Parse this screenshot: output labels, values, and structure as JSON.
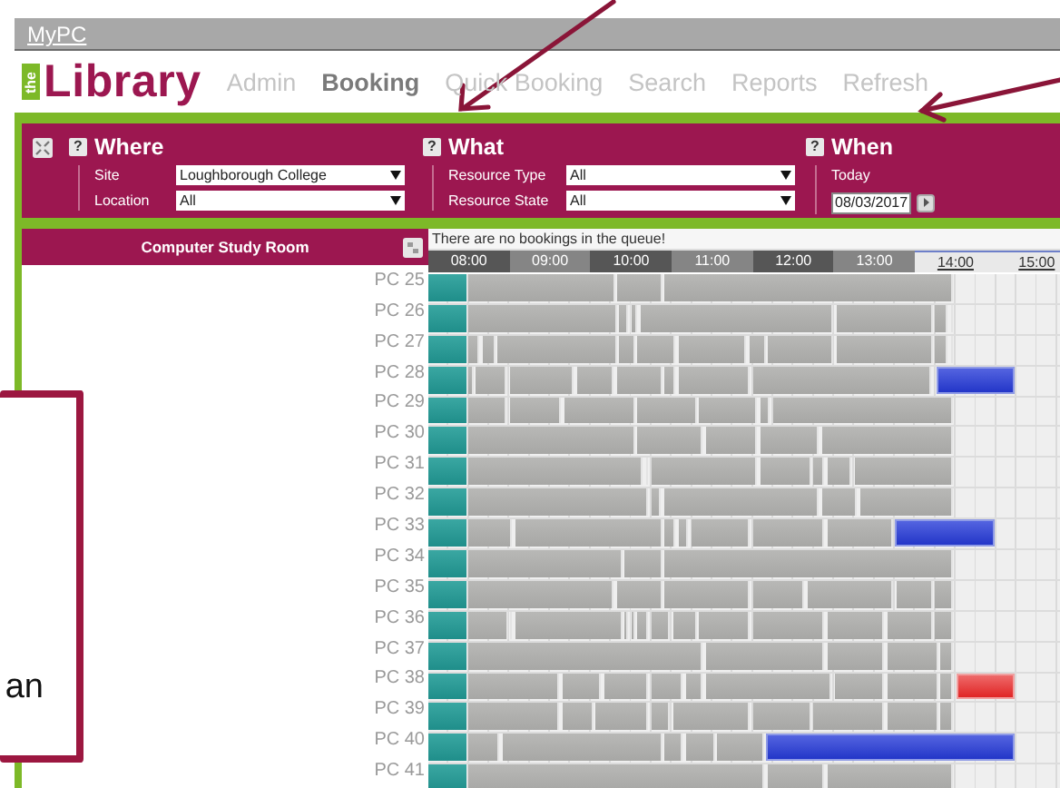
{
  "top_bar": {
    "link": "MyPC"
  },
  "header": {
    "logo_small": "the",
    "logo": "Library",
    "nav": [
      {
        "label": "Admin",
        "selected": false
      },
      {
        "label": "Booking",
        "selected": true
      },
      {
        "label": "Quick Booking",
        "selected": false
      },
      {
        "label": "Search",
        "selected": false
      },
      {
        "label": "Reports",
        "selected": false
      },
      {
        "label": "Refresh",
        "selected": false
      }
    ]
  },
  "filters": {
    "sections": [
      {
        "kind": "selects",
        "help": "?",
        "title": "Where",
        "fields": [
          {
            "label": "Site",
            "value": "Loughborough College"
          },
          {
            "label": "Location",
            "value": "All"
          }
        ]
      },
      {
        "kind": "selects",
        "help": "?",
        "title": "What",
        "fields": [
          {
            "label": "Resource Type",
            "value": "All"
          },
          {
            "label": "Resource State",
            "value": "All"
          }
        ]
      },
      {
        "kind": "date",
        "help": "?",
        "title": "When",
        "label": "Today",
        "value": "08/03/2017"
      }
    ]
  },
  "grid": {
    "room": "Computer Study Room",
    "queue_message": "There are no bookings in the queue!",
    "hours": [
      {
        "label": "08:00",
        "link": false
      },
      {
        "label": "09:00",
        "link": false
      },
      {
        "label": "10:00",
        "link": false
      },
      {
        "label": "11:00",
        "link": false
      },
      {
        "label": "12:00",
        "link": false
      },
      {
        "label": "13:00",
        "link": false
      },
      {
        "label": "14:00",
        "link": true
      },
      {
        "label": "15:00",
        "link": true
      }
    ],
    "rows": [
      {
        "name": "PC 25"
      },
      {
        "name": "PC 26"
      },
      {
        "name": "PC 27"
      },
      {
        "name": "PC 28"
      },
      {
        "name": "PC 29"
      },
      {
        "name": "PC 30"
      },
      {
        "name": "PC 31"
      },
      {
        "name": "PC 32"
      },
      {
        "name": "PC 33"
      },
      {
        "name": "PC 34"
      },
      {
        "name": "PC 35"
      },
      {
        "name": "PC 36"
      },
      {
        "name": "PC 37"
      },
      {
        "name": "PC 38"
      },
      {
        "name": "PC 39"
      },
      {
        "name": "PC 40"
      },
      {
        "name": "PC 41"
      }
    ]
  },
  "annotation": {
    "callout_text": "an"
  }
}
